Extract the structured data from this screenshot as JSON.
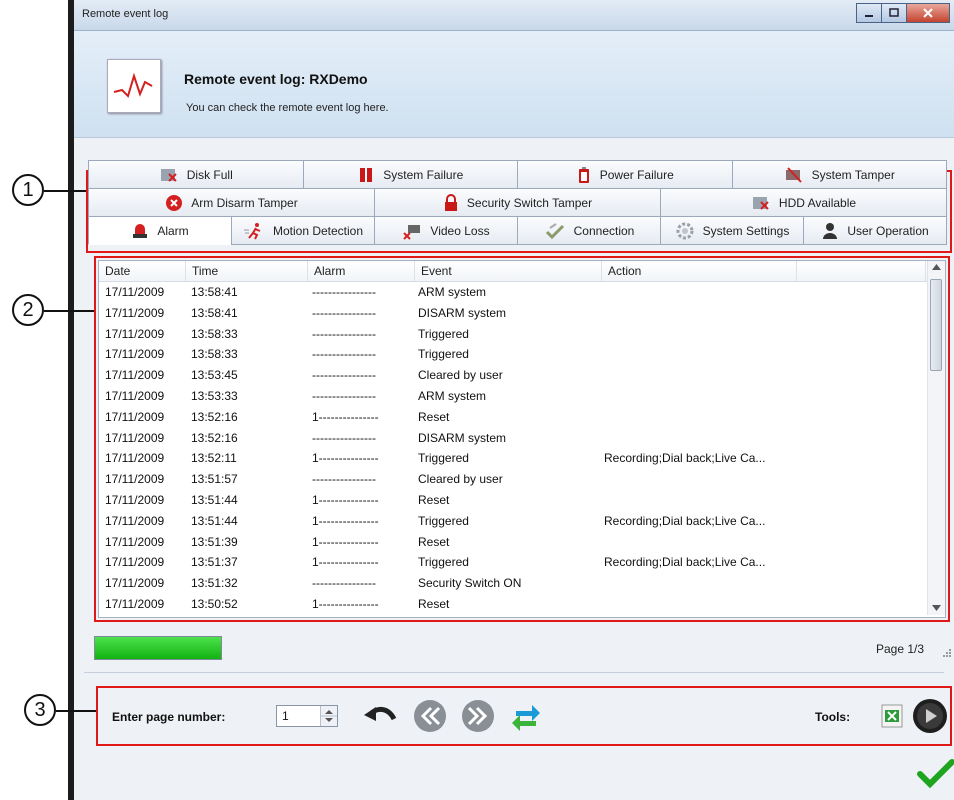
{
  "window": {
    "title": "Remote event log",
    "controls": [
      "minimize-icon",
      "maximize-icon",
      "close-icon"
    ]
  },
  "header": {
    "title": "Remote event log:  RXDemo",
    "subtitle": "You can check the remote event log here."
  },
  "callouts": [
    "1",
    "2",
    "3"
  ],
  "tabs": {
    "row1": [
      {
        "label": "Disk Full",
        "icon": "disk-full-icon"
      },
      {
        "label": "System Failure",
        "icon": "system-failure-icon"
      },
      {
        "label": "Power Failure",
        "icon": "power-failure-icon"
      },
      {
        "label": "System Tamper",
        "icon": "system-tamper-icon"
      }
    ],
    "row2": [
      {
        "label": "Arm Disarm Tamper",
        "icon": "arm-disarm-tamper-icon"
      },
      {
        "label": "Security Switch Tamper",
        "icon": "lock-icon"
      },
      {
        "label": "HDD Available",
        "icon": "hdd-available-icon"
      }
    ],
    "row3": [
      {
        "label": "Alarm",
        "icon": "alarm-siren-icon",
        "active": true
      },
      {
        "label": "Motion Detection",
        "icon": "motion-detection-icon"
      },
      {
        "label": "Video Loss",
        "icon": "video-loss-icon"
      },
      {
        "label": "Connection",
        "icon": "connection-icon"
      },
      {
        "label": "System Settings",
        "icon": "gear-icon"
      },
      {
        "label": "User Operation",
        "icon": "user-icon"
      }
    ]
  },
  "table": {
    "columns": [
      "Date",
      "Time",
      "Alarm",
      "Event",
      "Action",
      ""
    ],
    "rows": [
      [
        "17/11/2009",
        "13:58:41",
        "----------------",
        "ARM system",
        ""
      ],
      [
        "17/11/2009",
        "13:58:41",
        "----------------",
        "DISARM system",
        ""
      ],
      [
        "17/11/2009",
        "13:58:33",
        "----------------",
        "Triggered",
        ""
      ],
      [
        "17/11/2009",
        "13:58:33",
        "----------------",
        "Triggered",
        ""
      ],
      [
        "17/11/2009",
        "13:53:45",
        "----------------",
        "Cleared by user",
        ""
      ],
      [
        "17/11/2009",
        "13:53:33",
        "----------------",
        "ARM system",
        ""
      ],
      [
        "17/11/2009",
        "13:52:16",
        "1---------------",
        "Reset",
        ""
      ],
      [
        "17/11/2009",
        "13:52:16",
        "----------------",
        "DISARM system",
        ""
      ],
      [
        "17/11/2009",
        "13:52:11",
        "1---------------",
        "Triggered",
        "Recording;Dial back;Live Ca..."
      ],
      [
        "17/11/2009",
        "13:51:57",
        "----------------",
        "Cleared by user",
        ""
      ],
      [
        "17/11/2009",
        "13:51:44",
        "1---------------",
        "Reset",
        ""
      ],
      [
        "17/11/2009",
        "13:51:44",
        "1---------------",
        "Triggered",
        "Recording;Dial back;Live Ca..."
      ],
      [
        "17/11/2009",
        "13:51:39",
        "1---------------",
        "Reset",
        ""
      ],
      [
        "17/11/2009",
        "13:51:37",
        "1---------------",
        "Triggered",
        "Recording;Dial back;Live Ca..."
      ],
      [
        "17/11/2009",
        "13:51:32",
        "----------------",
        "Security Switch ON",
        ""
      ],
      [
        "17/11/2009",
        "13:50:52",
        "1---------------",
        "Reset",
        ""
      ]
    ]
  },
  "progress": {
    "value": 1.0,
    "color": "#22c722"
  },
  "pagination": {
    "page_info": "Page 1/3",
    "enter_label": "Enter page number:",
    "page_value": "1",
    "buttons": [
      "undo-icon",
      "previous-page-icon",
      "next-page-icon",
      "refresh-icon"
    ]
  },
  "tools": {
    "label": "Tools:",
    "buttons": [
      "excel-export-icon",
      "play-icon"
    ]
  },
  "ok": {
    "icon": "checkmark-icon"
  },
  "colors": {
    "highlight": "#e01818",
    "accent": "#22c722"
  }
}
